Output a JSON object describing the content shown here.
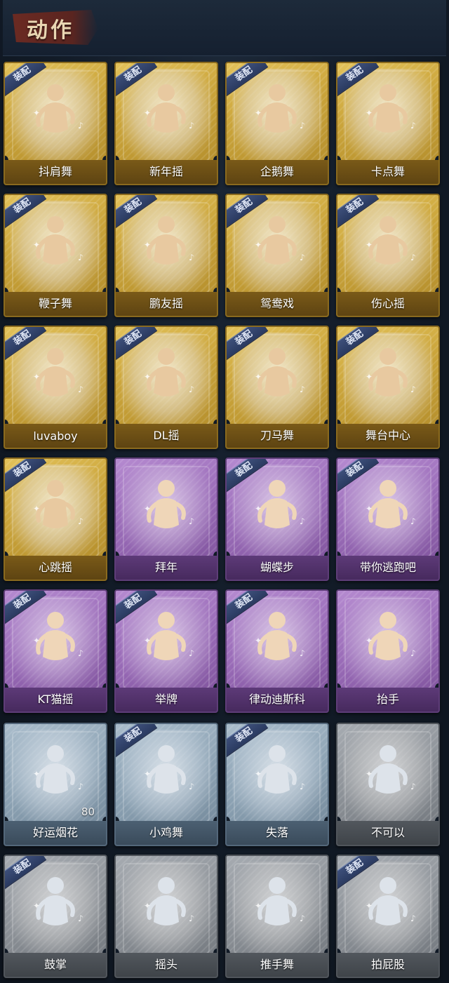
{
  "header": {
    "title": "动作"
  },
  "equip_label": "装配",
  "cards": [
    {
      "name": "抖肩舞",
      "tier": "gold",
      "equipped": true
    },
    {
      "name": "新年摇",
      "tier": "gold",
      "equipped": true
    },
    {
      "name": "企鹅舞",
      "tier": "gold",
      "equipped": true
    },
    {
      "name": "卡点舞",
      "tier": "gold",
      "equipped": true
    },
    {
      "name": "鞭子舞",
      "tier": "gold",
      "equipped": true
    },
    {
      "name": "鹏友摇",
      "tier": "gold",
      "equipped": true
    },
    {
      "name": "鸳鸯戏",
      "tier": "gold",
      "equipped": true
    },
    {
      "name": "伤心摇",
      "tier": "gold",
      "equipped": true
    },
    {
      "name": "luvaboy",
      "tier": "gold",
      "equipped": true
    },
    {
      "name": "DL摇",
      "tier": "gold",
      "equipped": true
    },
    {
      "name": "刀马舞",
      "tier": "gold",
      "equipped": true
    },
    {
      "name": "舞台中心",
      "tier": "gold",
      "equipped": true
    },
    {
      "name": "心跳摇",
      "tier": "gold",
      "equipped": true
    },
    {
      "name": "拜年",
      "tier": "purple",
      "equipped": false
    },
    {
      "name": "蝴蝶步",
      "tier": "purple",
      "equipped": true
    },
    {
      "name": "带你逃跑吧",
      "tier": "purple",
      "equipped": true
    },
    {
      "name": "KT猫摇",
      "tier": "purple",
      "equipped": true
    },
    {
      "name": "举牌",
      "tier": "purple",
      "equipped": true
    },
    {
      "name": "律动迪斯科",
      "tier": "purple",
      "equipped": true
    },
    {
      "name": "抬手",
      "tier": "purple",
      "equipped": false
    },
    {
      "name": "好运烟花",
      "tier": "blue",
      "equipped": false,
      "count": "80"
    },
    {
      "name": "小鸡舞",
      "tier": "blue",
      "equipped": true
    },
    {
      "name": "失落",
      "tier": "blue",
      "equipped": true
    },
    {
      "name": "不可以",
      "tier": "gray",
      "equipped": false
    },
    {
      "name": "鼓掌",
      "tier": "gray",
      "equipped": true
    },
    {
      "name": "摇头",
      "tier": "gray",
      "equipped": false
    },
    {
      "name": "推手舞",
      "tier": "gray",
      "equipped": false
    },
    {
      "name": "拍屁股",
      "tier": "gray",
      "equipped": true
    }
  ]
}
